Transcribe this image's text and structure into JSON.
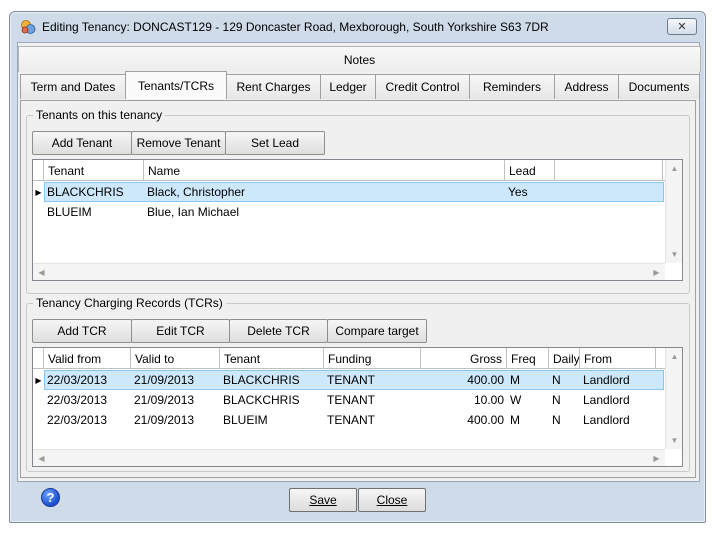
{
  "window": {
    "title": "Editing Tenancy: DONCAST129 - 129 Doncaster Road, Mexborough, South Yorkshire S63 7DR",
    "close_glyph": "✕"
  },
  "tabs": {
    "notes": "Notes",
    "row": [
      {
        "label": "Term and Dates",
        "active": false
      },
      {
        "label": "Tenants/TCRs",
        "active": true
      },
      {
        "label": "Rent Charges",
        "active": false
      },
      {
        "label": "Ledger",
        "active": false
      },
      {
        "label": "Credit Control",
        "active": false
      },
      {
        "label": "Reminders",
        "active": false
      },
      {
        "label": "Address",
        "active": false
      },
      {
        "label": "Documents",
        "active": false
      }
    ]
  },
  "tenants_group": {
    "title": "Tenants on this tenancy",
    "buttons": {
      "add": "Add Tenant",
      "remove": "Remove Tenant",
      "set_lead": "Set Lead"
    },
    "columns": [
      "Tenant",
      "Name",
      "Lead",
      ""
    ],
    "rows": [
      {
        "tenant": "BLACKCHRIS",
        "name": "Black, Christopher",
        "lead": "Yes",
        "selected": true
      },
      {
        "tenant": "BLUEIM",
        "name": "Blue, Ian Michael",
        "lead": "",
        "selected": false
      }
    ]
  },
  "tcr_group": {
    "title": "Tenancy Charging Records (TCRs)",
    "buttons": {
      "add": "Add TCR",
      "edit": "Edit TCR",
      "delete": "Delete TCR",
      "compare": "Compare target"
    },
    "columns": [
      "Valid from",
      "Valid to",
      "Tenant",
      "Funding",
      "Gross",
      "Freq",
      "Daily",
      "From"
    ],
    "rows": [
      {
        "valid_from": "22/03/2013",
        "valid_to": "21/09/2013",
        "tenant": "BLACKCHRIS",
        "funding": "TENANT",
        "gross": "400.00",
        "freq": "M",
        "daily": "N",
        "from": "Landlord",
        "selected": true
      },
      {
        "valid_from": "22/03/2013",
        "valid_to": "21/09/2013",
        "tenant": "BLACKCHRIS",
        "funding": "TENANT",
        "gross": "10.00",
        "freq": "W",
        "daily": "N",
        "from": "Landlord",
        "selected": false
      },
      {
        "valid_from": "22/03/2013",
        "valid_to": "21/09/2013",
        "tenant": "BLUEIM",
        "funding": "TENANT",
        "gross": "400.00",
        "freq": "M",
        "daily": "N",
        "from": "Landlord",
        "selected": false
      }
    ]
  },
  "footer": {
    "help_glyph": "?",
    "save_label": "Save",
    "close_label": "Close"
  },
  "colors": {
    "frame": "#cfdbe9",
    "selection": "#cde8fa",
    "selection_border": "#86c6ef",
    "help_icon": "#1d4fd0"
  }
}
